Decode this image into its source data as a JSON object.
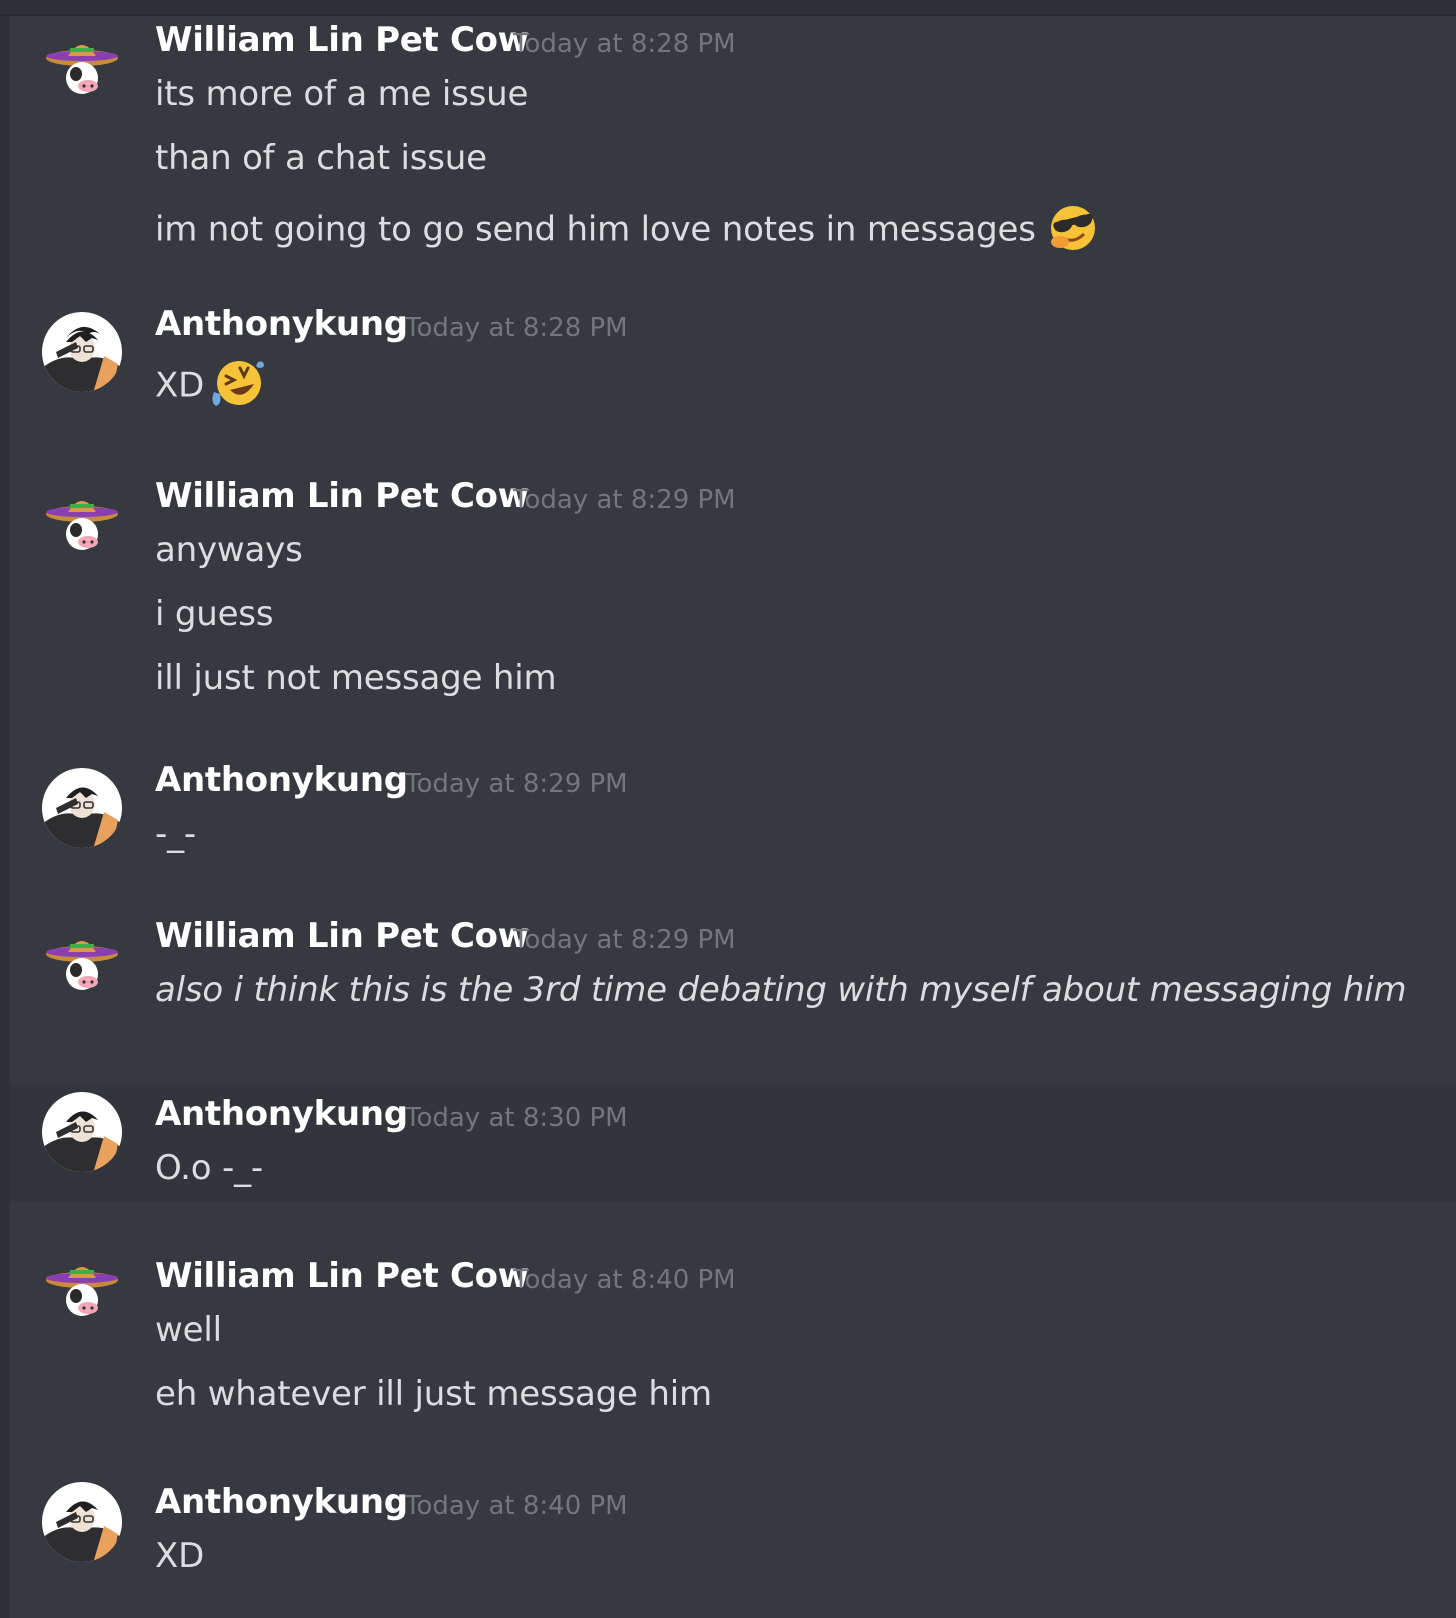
{
  "messages": [
    {
      "author": "William Lin Pet Cow",
      "timestamp": "Today at 8:28 PM",
      "avatar": "sombrero-cow-avatar",
      "lines": [
        {
          "text": "its more of a me issue"
        },
        {
          "text": "than of a chat issue"
        },
        {
          "text": "im not going to go send him love notes in messages",
          "emoji": "sunglasses-emoji"
        }
      ]
    },
    {
      "author": "Anthonykung",
      "timestamp": "Today at 8:28 PM",
      "avatar": "dabbing-boy-avatar",
      "lines": [
        {
          "text": "XD",
          "emoji": "rolling-on-floor-laughing-emoji"
        }
      ]
    },
    {
      "author": "William Lin Pet Cow",
      "timestamp": "Today at 8:29 PM",
      "avatar": "sombrero-cow-avatar",
      "lines": [
        {
          "text": "anyways"
        },
        {
          "text": "i guess"
        },
        {
          "text": "ill just not message him"
        }
      ]
    },
    {
      "author": "Anthonykung",
      "timestamp": "Today at 8:29 PM",
      "avatar": "dabbing-boy-avatar",
      "lines": [
        {
          "text": "-_-"
        }
      ]
    },
    {
      "author": "William Lin Pet Cow",
      "timestamp": "Today at 8:29 PM",
      "avatar": "sombrero-cow-avatar",
      "lines": [
        {
          "text": "also i think this is the 3rd time debating with myself about messaging him",
          "italic": true
        }
      ]
    },
    {
      "author": "Anthonykung",
      "timestamp": "Today at 8:30 PM",
      "avatar": "dabbing-boy-avatar",
      "highlighted": true,
      "lines": [
        {
          "text": "O.o -_-"
        }
      ]
    },
    {
      "author": "William Lin Pet Cow",
      "timestamp": "Today at 8:40 PM",
      "avatar": "sombrero-cow-avatar",
      "lines": [
        {
          "text": "well"
        },
        {
          "text": "eh whatever ill just message him"
        }
      ]
    },
    {
      "author": "Anthonykung",
      "timestamp": "Today at 8:40 PM",
      "avatar": "dabbing-boy-avatar",
      "lines": [
        {
          "text": "XD"
        }
      ]
    }
  ],
  "colors": {
    "background": "#36393f",
    "highlight": "#32353b",
    "author": "#ffffff",
    "timestamp": "#72767d",
    "text": "#dcddde"
  }
}
